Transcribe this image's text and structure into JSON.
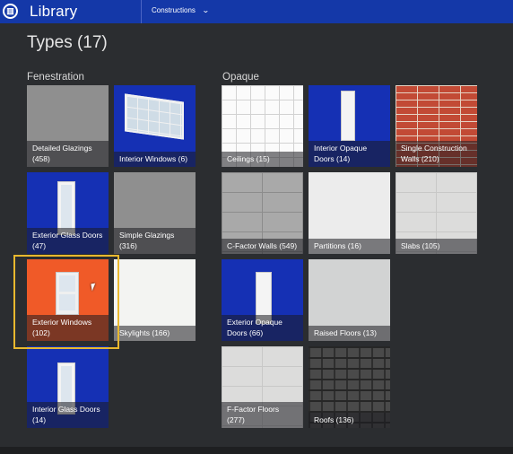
{
  "app": {
    "title": "Library",
    "icon": "library-icon"
  },
  "toolbar": {
    "dropdown_label": "Constructions",
    "dropdown_icon": "chevron-down-icon"
  },
  "heading": "Types (17)",
  "sections": {
    "fenestration": "Fenestration",
    "opaque": "Opaque"
  },
  "tiles": {
    "detailed_glazings": {
      "line1": "Detailed Glazings",
      "line2": "(458)"
    },
    "interior_windows": {
      "line1": "Interior Windows (6)"
    },
    "exterior_glass_doors": {
      "line1": "Exterior Glass Doors",
      "line2": "(47)"
    },
    "simple_glazings": {
      "line1": "Simple Glazings",
      "line2": "(316)"
    },
    "exterior_windows": {
      "line1": "Exterior Windows",
      "line2": "(102)"
    },
    "skylights": {
      "line1": "Skylights (166)"
    },
    "interior_glass_doors": {
      "line1": "Interior Glass Doors",
      "line2": "(14)"
    },
    "ceilings": {
      "line1": "Ceilings (15)"
    },
    "interior_opaque_doors": {
      "line1": "Interior Opaque",
      "line2": "Doors (14)"
    },
    "single_construction_walls": {
      "line1": "Single Construction",
      "line2": "Walls (210)"
    },
    "c_factor_walls": {
      "line1": "C-Factor Walls (549)"
    },
    "partitions": {
      "line1": "Partitions (16)"
    },
    "slabs": {
      "line1": "Slabs (105)"
    },
    "exterior_opaque_doors": {
      "line1": "Exterior Opaque",
      "line2": "Doors (66)"
    },
    "raised_floors": {
      "line1": "Raised Floors (13)"
    },
    "f_factor_floors": {
      "line1": "F-Factor Floors (277)"
    },
    "roofs": {
      "line1": "Roofs (136)"
    }
  },
  "colors": {
    "topbar": "#1438a8",
    "background": "#2b2d30",
    "tile_blue": "#1530b4",
    "tile_orange": "#f05a28",
    "selection": "#e9b82e"
  },
  "selected_tile": "Exterior Windows"
}
